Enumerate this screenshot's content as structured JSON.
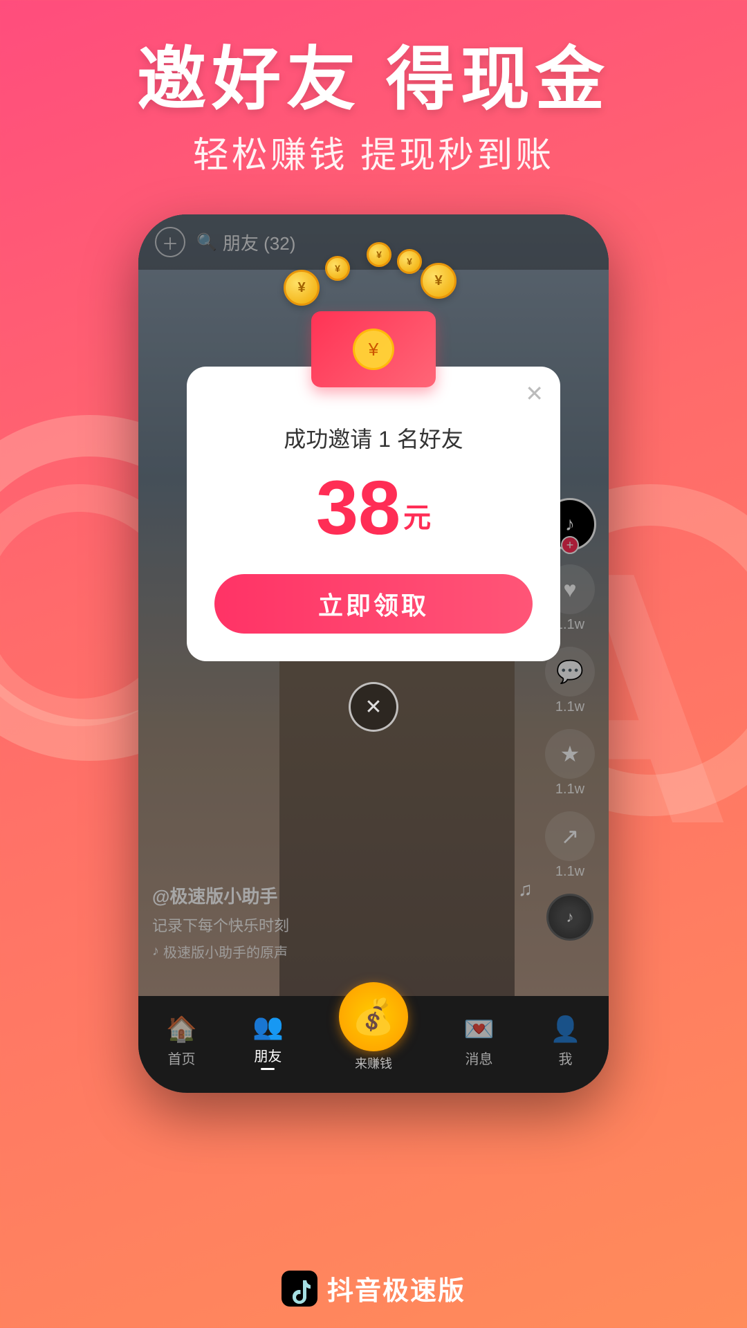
{
  "header": {
    "title": "邀好友 得现金",
    "subtitle": "轻松赚钱 提现秒到账"
  },
  "phone": {
    "topbar": {
      "add_label": "+",
      "search_text": "朋友 (32)"
    },
    "side_actions": [
      {
        "icon": "♥",
        "label": "1.1w"
      },
      {
        "icon": "💬",
        "label": "1.1w"
      },
      {
        "icon": "★",
        "label": "1.1w"
      },
      {
        "icon": "↗",
        "label": "1.1w"
      }
    ],
    "caption": {
      "username": "@极速版小助手",
      "desc": "记录下每个快乐时刻",
      "music": "极速版小助手的原声"
    },
    "nav": {
      "items": [
        {
          "label": "首页",
          "active": false
        },
        {
          "label": "朋友",
          "active": true
        },
        {
          "label": "来赚钱",
          "active": false,
          "special": true
        },
        {
          "label": "消息",
          "active": false
        },
        {
          "label": "我",
          "active": false
        }
      ]
    }
  },
  "popup": {
    "close_icon": "✕",
    "title": "成功邀请 1 名好友",
    "amount": "38",
    "unit": "元",
    "claim_button": "立即领取",
    "dismiss_icon": "✕"
  },
  "brand": {
    "app_name": "抖音极速版"
  }
}
